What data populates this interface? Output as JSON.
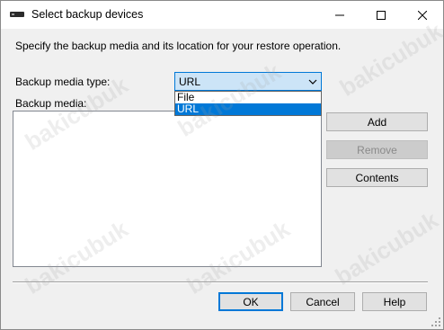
{
  "window": {
    "title": "Select backup devices",
    "controls": {
      "minimize": "minimize",
      "maximize": "maximize",
      "close": "close"
    }
  },
  "intro": "Specify the backup media and its location for your restore operation.",
  "media_type": {
    "label": "Backup media type:",
    "selected": "URL",
    "options": [
      "File",
      "URL"
    ],
    "highlighted_option": "URL"
  },
  "media_list": {
    "label": "Backup media:",
    "items": []
  },
  "side_buttons": {
    "add": "Add",
    "remove": "Remove",
    "contents": "Contents"
  },
  "footer": {
    "ok": "OK",
    "cancel": "Cancel",
    "help": "Help"
  },
  "watermark": "bakicubuk",
  "colors": {
    "accent": "#0078d7",
    "combo_bg": "#cce4f7",
    "dialog_bg": "#f0f0f0"
  }
}
